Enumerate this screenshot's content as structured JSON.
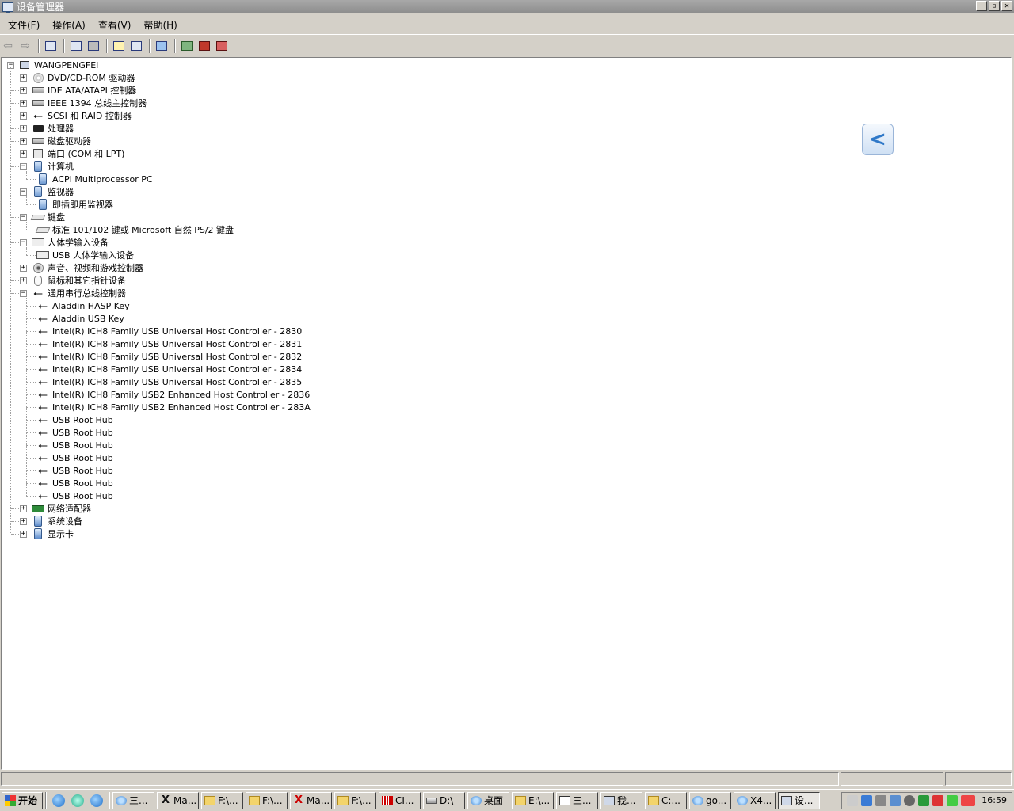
{
  "window": {
    "title": "设备管理器",
    "controls": [
      "_",
      "▫",
      "✕"
    ]
  },
  "menubar": {
    "items": [
      "文件(F)",
      "操作(A)",
      "查看(V)",
      "帮助(H)"
    ]
  },
  "tree": {
    "root": "WANGPENGFEI",
    "rows": [
      {
        "label": "DVD/CD-ROM 驱动器",
        "level": 1,
        "expander": "+",
        "icon": "cd-icon"
      },
      {
        "label": "IDE ATA/ATAPI 控制器",
        "level": 1,
        "expander": "+",
        "icon": "drive-icon"
      },
      {
        "label": "IEEE 1394 总线主控制器",
        "level": 1,
        "expander": "+",
        "icon": "drive-icon"
      },
      {
        "label": "SCSI 和 RAID 控制器",
        "level": 1,
        "expander": "+",
        "icon": "usb-icon"
      },
      {
        "label": "处理器",
        "level": 1,
        "expander": "+",
        "icon": "chip-icon"
      },
      {
        "label": "磁盘驱动器",
        "level": 1,
        "expander": "+",
        "icon": "drive-icon"
      },
      {
        "label": "端口 (COM 和 LPT)",
        "level": 1,
        "expander": "+",
        "icon": "port-icon"
      },
      {
        "label": "计算机",
        "level": 1,
        "expander": "−",
        "icon": "monitor-icon"
      },
      {
        "label": "ACPI Multiprocessor PC",
        "level": 2,
        "icon": "monitor-icon"
      },
      {
        "label": "监视器",
        "level": 1,
        "expander": "−",
        "icon": "monitor-icon"
      },
      {
        "label": "即插即用监视器",
        "level": 2,
        "icon": "monitor-icon"
      },
      {
        "label": "键盘",
        "level": 1,
        "expander": "−",
        "icon": "keyboard-icon"
      },
      {
        "label": "标准 101/102 键或 Microsoft 自然 PS/2 键盘",
        "level": 2,
        "icon": "keyboard-icon"
      },
      {
        "label": "人体学输入设备",
        "level": 1,
        "expander": "−",
        "icon": "hid-icon"
      },
      {
        "label": "USB 人体学输入设备",
        "level": 2,
        "icon": "hid-icon"
      },
      {
        "label": "声音、视频和游戏控制器",
        "level": 1,
        "expander": "+",
        "icon": "sound-icon"
      },
      {
        "label": "鼠标和其它指针设备",
        "level": 1,
        "expander": "+",
        "icon": "mouse-icon"
      },
      {
        "label": "通用串行总线控制器",
        "level": 1,
        "expander": "−",
        "icon": "usb-icon"
      },
      {
        "label": "Aladdin HASP Key",
        "level": 2,
        "icon": "usb-icon"
      },
      {
        "label": "Aladdin USB Key",
        "level": 2,
        "icon": "usb-icon"
      },
      {
        "label": "Intel(R) ICH8 Family USB Universal Host Controller - 2830",
        "level": 2,
        "icon": "usb-icon"
      },
      {
        "label": "Intel(R) ICH8 Family USB Universal Host Controller - 2831",
        "level": 2,
        "icon": "usb-icon"
      },
      {
        "label": "Intel(R) ICH8 Family USB Universal Host Controller - 2832",
        "level": 2,
        "icon": "usb-icon"
      },
      {
        "label": "Intel(R) ICH8 Family USB Universal Host Controller - 2834",
        "level": 2,
        "icon": "usb-icon"
      },
      {
        "label": "Intel(R) ICH8 Family USB Universal Host Controller - 2835",
        "level": 2,
        "icon": "usb-icon"
      },
      {
        "label": "Intel(R) ICH8 Family USB2 Enhanced Host Controller - 2836",
        "level": 2,
        "icon": "usb-icon"
      },
      {
        "label": "Intel(R) ICH8 Family USB2 Enhanced Host Controller - 283A",
        "level": 2,
        "icon": "usb-icon"
      },
      {
        "label": "USB Root Hub",
        "level": 2,
        "icon": "usb-icon"
      },
      {
        "label": "USB Root Hub",
        "level": 2,
        "icon": "usb-icon"
      },
      {
        "label": "USB Root Hub",
        "level": 2,
        "icon": "usb-icon"
      },
      {
        "label": "USB Root Hub",
        "level": 2,
        "icon": "usb-icon"
      },
      {
        "label": "USB Root Hub",
        "level": 2,
        "icon": "usb-icon"
      },
      {
        "label": "USB Root Hub",
        "level": 2,
        "icon": "usb-icon"
      },
      {
        "label": "USB Root Hub",
        "level": 2,
        "icon": "usb-icon"
      },
      {
        "label": "网络适配器",
        "level": 1,
        "expander": "+",
        "icon": "network-icon"
      },
      {
        "label": "系统设备",
        "level": 1,
        "expander": "+",
        "icon": "system-icon"
      },
      {
        "label": "显示卡",
        "level": 1,
        "expander": "+",
        "icon": "system-icon"
      }
    ]
  },
  "taskbar": {
    "start_label": "开始",
    "buttons": [
      {
        "label": "三...",
        "icon": "ie"
      },
      {
        "label": "Ma...",
        "icon": "x2"
      },
      {
        "label": "F:\\...",
        "icon": "folder"
      },
      {
        "label": "F:\\...",
        "icon": "folder"
      },
      {
        "label": "Ma...",
        "icon": "x"
      },
      {
        "label": "F:\\...",
        "icon": "folder"
      },
      {
        "label": "CI...",
        "icon": "red"
      },
      {
        "label": "D:\\",
        "icon": "drive"
      },
      {
        "label": "桌面",
        "icon": "ie"
      },
      {
        "label": "E:\\...",
        "icon": "folder"
      },
      {
        "label": "三...",
        "icon": "doc"
      },
      {
        "label": "我...",
        "icon": "pc"
      },
      {
        "label": "C:...",
        "icon": "folder"
      },
      {
        "label": "go...",
        "icon": "ie"
      },
      {
        "label": "X4...",
        "icon": "ie"
      },
      {
        "label": "设...",
        "icon": "pc"
      }
    ],
    "clock": "16:59"
  },
  "colors": {
    "titlebar": "#8c8c8c",
    "window_bg": "#d4d0c8",
    "tree_bg": "#ffffff"
  }
}
